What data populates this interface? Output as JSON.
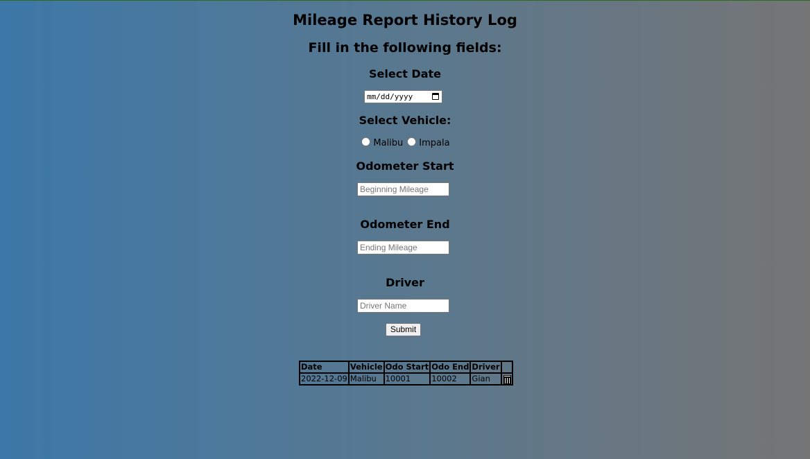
{
  "page": {
    "title": "Mileage Report History Log",
    "subtitle": "Fill in the following fields:"
  },
  "form": {
    "date_label": "Select Date",
    "date_placeholder": "mm/dd/yyyy",
    "vehicle_label": "Select Vehicle:",
    "vehicle_options": [
      "Malibu",
      "Impala"
    ],
    "odo_start_label": "Odometer Start",
    "odo_start_placeholder": "Beginning Mileage",
    "odo_end_label": "Odometer End",
    "odo_end_placeholder": "Ending Mileage",
    "driver_label": "Driver",
    "driver_placeholder": "Driver Name",
    "submit_label": "Submit"
  },
  "table": {
    "headers": [
      "Date",
      "Vehicle",
      "Odo Start",
      "Odo End",
      "Driver"
    ],
    "rows": [
      {
        "date": "2022-12-09",
        "vehicle": "Malibu",
        "odo_start": "10001",
        "odo_end": "10002",
        "driver": "Gian",
        "action_icon": "trash-icon"
      }
    ]
  },
  "colors": {
    "gradient_left": "#3d78a8",
    "gradient_right": "#757575",
    "top_border": "#2e6b1e"
  }
}
